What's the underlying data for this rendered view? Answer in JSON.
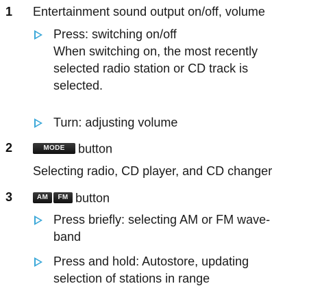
{
  "items": [
    {
      "number": "1",
      "title": "Entertainment sound output on/off, volume",
      "bullets": [
        {
          "lines": [
            "Press: switching on/off",
            "When switching on, the most recently",
            "selected radio station or CD track is",
            "selected."
          ]
        },
        {
          "lines": [
            "Turn: adjusting volume"
          ]
        }
      ]
    },
    {
      "number": "2",
      "chip_labels": [
        "MODE"
      ],
      "title_suffix": "button",
      "description": "Selecting radio, CD player, and CD changer"
    },
    {
      "number": "3",
      "chip_labels": [
        "AM",
        "FM"
      ],
      "title_suffix": "button",
      "bullets": [
        {
          "lines": [
            "Press briefly: selecting AM or FM wave-",
            "band"
          ]
        },
        {
          "lines": [
            "Press and hold: Autostore, updating",
            "selection of stations in range"
          ]
        }
      ]
    }
  ],
  "colors": {
    "arrow": "#3aa7d8",
    "text": "#1a1a1a",
    "chip": "#1f1f1f"
  },
  "icons": {
    "bullet": "triangle-arrow-icon"
  }
}
